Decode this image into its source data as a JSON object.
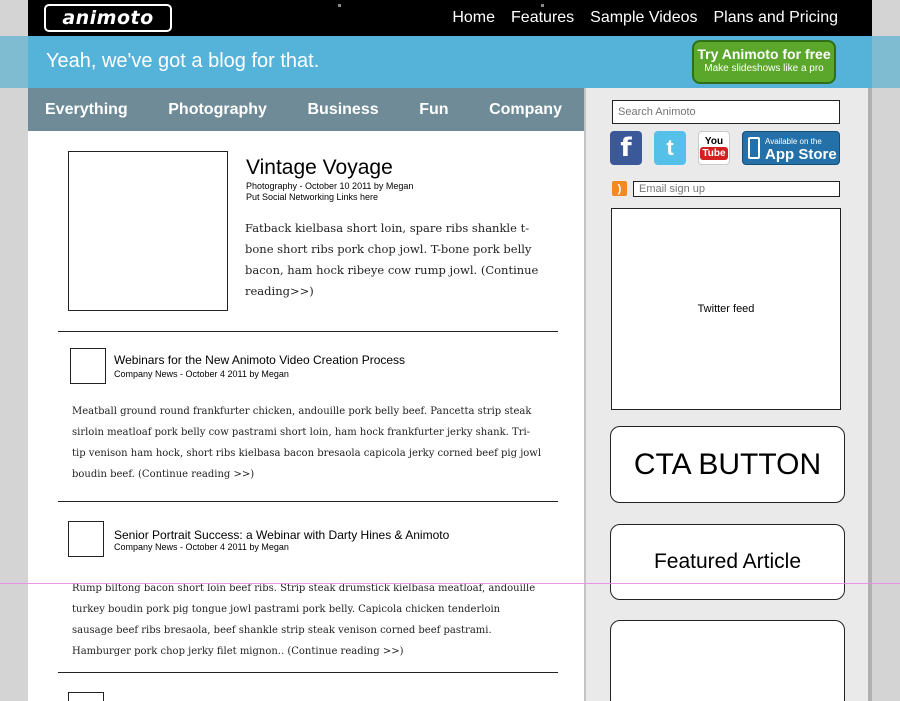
{
  "header": {
    "logo_text": "animoto",
    "nav": [
      "Home",
      "Features",
      "Sample Videos",
      "Plans and Pricing"
    ]
  },
  "banner": {
    "tagline": "Yeah, we've got a blog for that.",
    "cta_title": "Try Animoto for free",
    "cta_subtitle": "Make slideshows like a pro"
  },
  "categories": [
    "Everything",
    "Photography",
    "Business",
    "Fun",
    "Company"
  ],
  "featured_post": {
    "title": "Vintage Voyage",
    "meta": "Photography - October 10 2011 by Megan",
    "social_links": "Put Social Networking Links here",
    "excerpt": "Fatback kielbasa short loin, spare ribs shankle t-bone short ribs pork chop jowl. T-bone pork belly bacon, ham hock ribeye cow rump jowl. (Continue reading>>)"
  },
  "posts": [
    {
      "title": "Webinars for the New Animoto Video Creation Process",
      "meta": "Company News - October 4 2011 by Megan",
      "excerpt": "Meatball ground round frankfurter chicken, andouille pork belly beef. Pancetta strip steak sirloin meatloaf pork belly cow pastrami short loin, ham hock frankfurter jerky shank. Tri-tip venison ham hock, short ribs kielbasa bacon bresaola capicola jerky corned beef pig jowl boudin beef. (Continue reading >>)"
    },
    {
      "title": "Senior Portrait Success: a Webinar with Darty Hines & Animoto",
      "meta": "Company News - October 4 2011 by Megan",
      "excerpt": "Rump biltong bacon short loin beef ribs. Strip steak drumstick kielbasa meatloaf, andouille turkey boudin pork pig tongue jowl pastrami pork belly. Capicola chicken tenderloin sausage beef ribs bresaola, beef shankle strip steak venison corned beef pastrami. Hamburger pork chop jerky filet mignon.. (Continue reading >>)"
    }
  ],
  "sidebar": {
    "search_placeholder": "Search Animoto",
    "social": {
      "facebook_glyph": "f",
      "twitter_glyph": "t",
      "youtube_you": "You",
      "youtube_tube": "Tube",
      "appstore_line1": "Available on the",
      "appstore_line2": "App Store"
    },
    "email_signup": "Email sign up",
    "twitter_feed": "Twitter feed",
    "cta_button": "CTA BUTTON",
    "featured_article": "Featured Article"
  },
  "colors": {
    "banner": "#55b3d9",
    "category_nav": "#6e8b97",
    "cta_green": "#5aa72c",
    "sidebar": "#eaeaea"
  }
}
